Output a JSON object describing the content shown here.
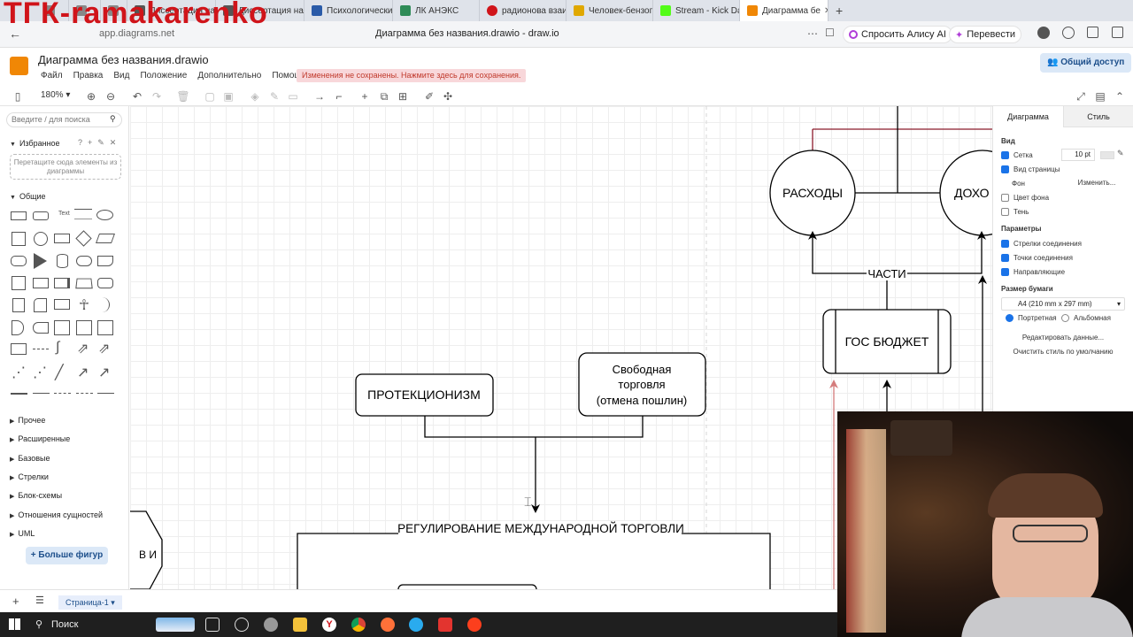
{
  "watermark": "ТГК-ramakarenko",
  "browser": {
    "tabs": [
      {
        "label": "Диссертация на",
        "color": "#555555"
      },
      {
        "label": "Диссертация на",
        "color": "#555555"
      },
      {
        "label": "Психологически",
        "color": "#2b5ba8"
      },
      {
        "label": "ЛК АНЭКС",
        "color": "#2e8b57"
      },
      {
        "label": "радионова взаи",
        "color": "#d0141a"
      },
      {
        "label": "Человек-бензоп",
        "color": "#e0a800"
      },
      {
        "label": "Stream - Kick Das",
        "color": "#53fc18"
      },
      {
        "label": "Диаграмма бе",
        "color": "#f08705"
      }
    ],
    "url": "app.diagrams.net",
    "page_title": "Диаграмма без названия.drawio - draw.io",
    "alice_label": "Спросить Алису AI",
    "translate_label": "Перевести"
  },
  "drawio": {
    "doc_title": "Диаграмма без названия.drawio",
    "menu": [
      "Файл",
      "Правка",
      "Вид",
      "Положение",
      "Дополнительно",
      "Помощь"
    ],
    "unsaved_notice": "Изменения не сохранены. Нажмите здесь для сохранения.",
    "share_label": "Общий доступ",
    "zoom": "180%"
  },
  "sidebar": {
    "search_placeholder": "Введите / для поиска",
    "favorites_title": "Избранное",
    "favorites_drop": "Перетащите сюда элементы из диаграммы",
    "general_title": "Общие",
    "sections": [
      "Прочее",
      "Расширенные",
      "Базовые",
      "Стрелки",
      "Блок-схемы",
      "Отношения сущностей",
      "UML"
    ],
    "more_shapes": "+ Больше фигур"
  },
  "diagram": {
    "nodes": {
      "protectionism": "ПРОТЕКЦИОНИЗМ",
      "free_trade": [
        "Свободная",
        "торговля",
        "(отмена пошлин)"
      ],
      "regulation": "РЕГУЛИРОВАНИЕ МЕЖДУНАРОДНОЙ ТОРГОВЛИ",
      "expenses": "РАСХОДЫ",
      "income": "ДОХО",
      "parts": "ЧАСТИ",
      "budget": "ГОС БЮДЖЕТ",
      "left_partial": "В И"
    }
  },
  "right_panel": {
    "tabs": [
      "Диаграмма",
      "Стиль"
    ],
    "view_title": "Вид",
    "grid_label": "Сетка",
    "grid_size": "10 pt",
    "page_view_label": "Вид страницы",
    "background_label": "Фон",
    "change_label": "Изменить...",
    "bgcolor_label": "Цвет фона",
    "shadow_label": "Тень",
    "params_title": "Параметры",
    "arrows_label": "Стрелки соединения",
    "points_label": "Точки соединения",
    "guides_label": "Направляющие",
    "paper_title": "Размер бумаги",
    "paper_size": "A4 (210 mm x 297 mm)",
    "portrait_label": "Портретная",
    "landscape_label": "Альбомная",
    "edit_data": "Редактировать данные...",
    "clear_style": "Очистить стиль по умолчанию"
  },
  "bottom": {
    "page_tab": "Страница-1"
  },
  "taskbar": {
    "search_label": "Поиск"
  }
}
